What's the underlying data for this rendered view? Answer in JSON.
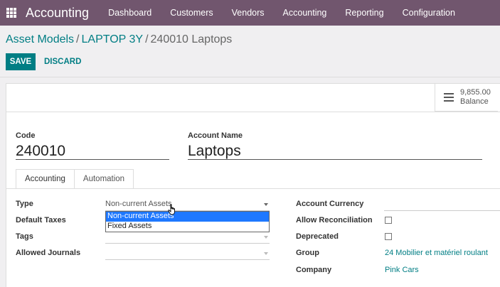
{
  "navbar": {
    "app_name": "Accounting",
    "menu": [
      "Dashboard",
      "Customers",
      "Vendors",
      "Accounting",
      "Reporting",
      "Configuration"
    ]
  },
  "breadcrumb": {
    "parent": "Asset Models",
    "record": "LAPTOP 3Y",
    "current": "240010 Laptops"
  },
  "actions": {
    "save": "SAVE",
    "discard": "DISCARD"
  },
  "balance": {
    "amount": "9,855.00",
    "label": "Balance"
  },
  "form": {
    "code_label": "Code",
    "code_value": "240010",
    "name_label": "Account Name",
    "name_value": "Laptops"
  },
  "tabs": [
    "Accounting",
    "Automation"
  ],
  "left_fields": {
    "type_label": "Type",
    "type_value": "Non-current Assets",
    "default_taxes_label": "Default Taxes",
    "tags_label": "Tags",
    "allowed_journals_label": "Allowed Journals"
  },
  "dropdown_options": [
    "Non-current Assets",
    "Fixed Assets"
  ],
  "right_fields": {
    "currency_label": "Account Currency",
    "reconciliation_label": "Allow Reconciliation",
    "deprecated_label": "Deprecated",
    "group_label": "Group",
    "group_value": "24 Mobilier et matériel roulant",
    "company_label": "Company",
    "company_value": "Pink Cars"
  }
}
